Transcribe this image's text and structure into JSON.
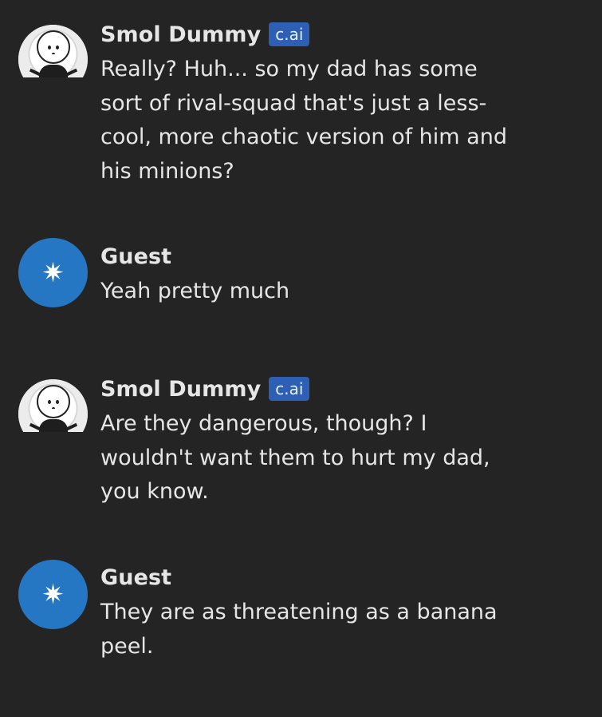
{
  "messages": [
    {
      "sender": "Smol Dummy",
      "badge": "c.ai",
      "avatar": "stick-figure-avatar",
      "lines": [
        "Really? Huh... so my dad has some",
        "sort of rival-squad that's just a less-",
        "cool, more chaotic version of him and",
        "his minions?"
      ]
    },
    {
      "sender": "Guest",
      "avatar": "asterisk-icon",
      "lines": [
        "Yeah pretty much"
      ]
    },
    {
      "sender": "Smol Dummy",
      "badge": "c.ai",
      "avatar": "stick-figure-avatar",
      "lines": [
        "Are they dangerous, though? I",
        "wouldn't want them to hurt my dad,",
        "you know."
      ]
    },
    {
      "sender": "Guest",
      "avatar": "asterisk-icon",
      "lines": [
        "They are as threatening as a banana",
        "peel."
      ]
    }
  ],
  "colors": {
    "background": "#242424",
    "text": "#e6e6e6",
    "badge": "#2d5fb4",
    "guest_avatar": "#2577c4"
  }
}
